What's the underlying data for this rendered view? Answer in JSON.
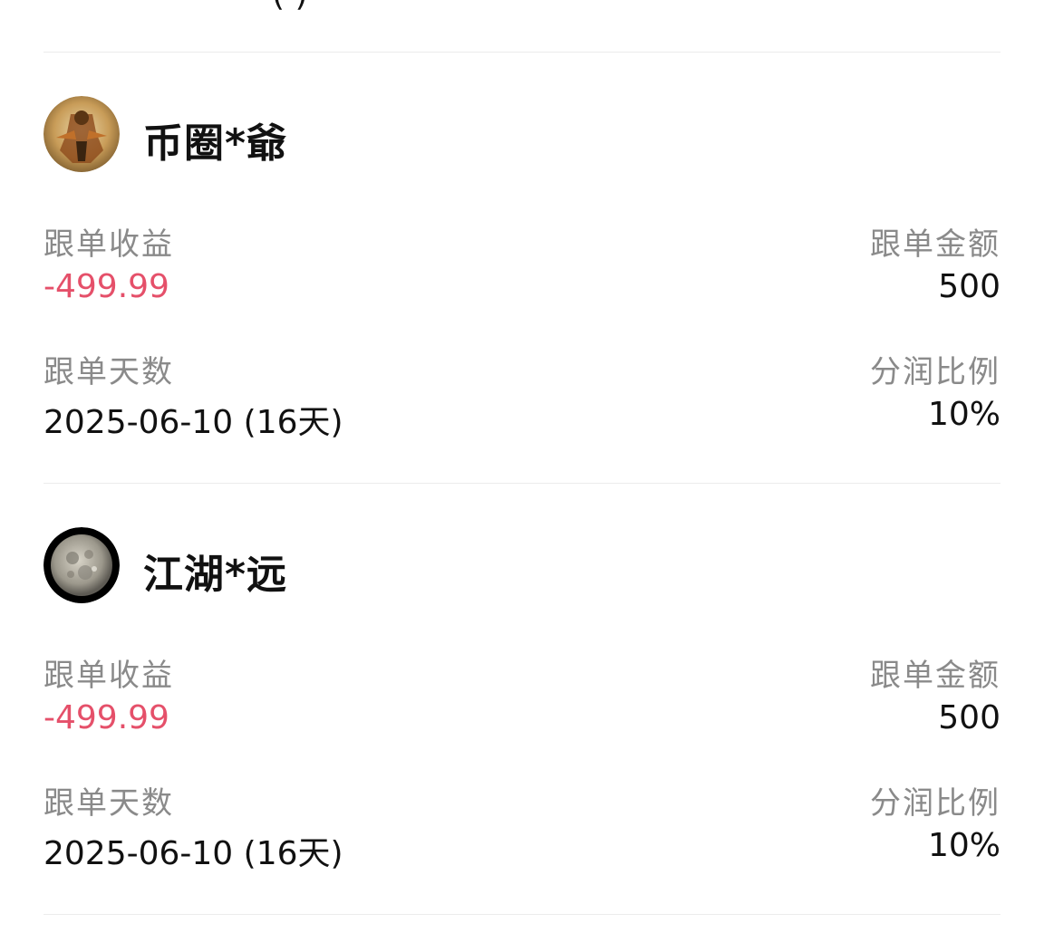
{
  "previous_item": {
    "visible_fragment": "(          )"
  },
  "followers": [
    {
      "name": "币圈*爺",
      "avatar_icon": "warrior-avatar-icon",
      "profit_label": "跟单收益",
      "profit_value": "-499.99",
      "amount_label": "跟单金额",
      "amount_value": "500",
      "days_label": "跟单天数",
      "days_value": "2025-06-10 (16天)",
      "share_label": "分润比例",
      "share_value": "10%"
    },
    {
      "name": "江湖*远",
      "avatar_icon": "moon-avatar-icon",
      "profit_label": "跟单收益",
      "profit_value": "-499.99",
      "amount_label": "跟单金额",
      "amount_value": "500",
      "days_label": "跟单天数",
      "days_value": "2025-06-10 (16天)",
      "share_label": "分润比例",
      "share_value": "10%"
    }
  ],
  "colors": {
    "negative": "#e5506a",
    "label": "#8a8a8a",
    "divider": "#ececec"
  }
}
